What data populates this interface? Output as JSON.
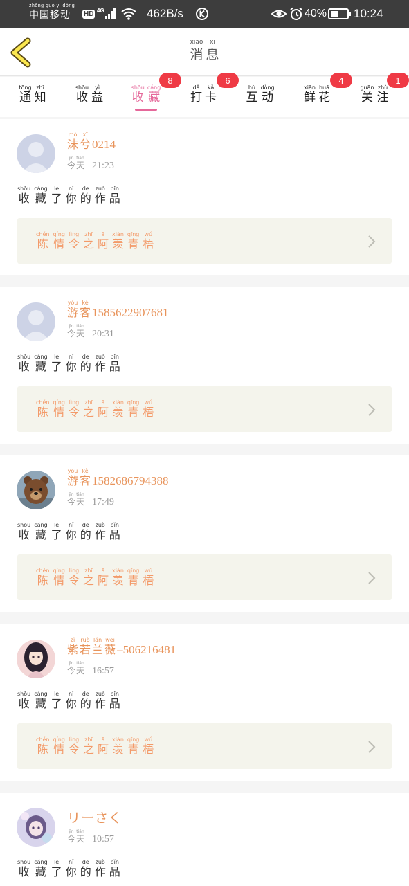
{
  "status_bar": {
    "carrier_pinyin": "zhōng guó yí dòng",
    "carrier": "中国移动",
    "hd": "HD",
    "network": "4G",
    "speed": "462B/s",
    "battery": "40%",
    "time": "10:24"
  },
  "header": {
    "title": [
      {
        "py": "xiāo",
        "hz": "消"
      },
      {
        "py": "xī",
        "hz": "息"
      }
    ]
  },
  "tabs": [
    {
      "chars": [
        {
          "py": "tōng",
          "hz": "通"
        },
        {
          "py": "zhī",
          "hz": "知"
        }
      ],
      "badge": "",
      "active": false
    },
    {
      "chars": [
        {
          "py": "shōu",
          "hz": "收"
        },
        {
          "py": "yì",
          "hz": "益"
        }
      ],
      "badge": "",
      "active": false
    },
    {
      "chars": [
        {
          "py": "shōu",
          "hz": "收"
        },
        {
          "py": "cáng",
          "hz": "藏"
        }
      ],
      "badge": "8",
      "active": true
    },
    {
      "chars": [
        {
          "py": "dǎ",
          "hz": "打"
        },
        {
          "py": "kǎ",
          "hz": "卡"
        }
      ],
      "badge": "6",
      "active": false
    },
    {
      "chars": [
        {
          "py": "hù",
          "hz": "互"
        },
        {
          "py": "dòng",
          "hz": "动"
        }
      ],
      "badge": "",
      "active": false
    },
    {
      "chars": [
        {
          "py": "xiān",
          "hz": "鲜"
        },
        {
          "py": "huā",
          "hz": "花"
        }
      ],
      "badge": "4",
      "active": false
    },
    {
      "chars": [
        {
          "py": "guān",
          "hz": "关"
        },
        {
          "py": "zhù",
          "hz": "注"
        }
      ],
      "badge": "1",
      "active": false
    }
  ],
  "common": {
    "today": [
      {
        "py": "jīn",
        "hz": "今"
      },
      {
        "py": "tiān",
        "hz": "天"
      }
    ],
    "action": [
      {
        "py": "shōu",
        "hz": "收"
      },
      {
        "py": "cáng",
        "hz": "藏"
      },
      {
        "py": "le",
        "hz": "了"
      },
      {
        "py": "nǐ",
        "hz": "你"
      },
      {
        "py": "de",
        "hz": "的"
      },
      {
        "py": "zuò",
        "hz": "作"
      },
      {
        "py": "pǐn",
        "hz": "品"
      }
    ],
    "work": [
      {
        "py": "chén",
        "hz": "陈"
      },
      {
        "py": "qíng",
        "hz": "情"
      },
      {
        "py": "lìng",
        "hz": "令"
      },
      {
        "py": "zhī",
        "hz": "之"
      },
      {
        "py": "ā",
        "hz": "阿"
      },
      {
        "py": "xiàn",
        "hz": "羡"
      },
      {
        "py": "qīng",
        "hz": "青"
      },
      {
        "py": "wú",
        "hz": "梧"
      }
    ]
  },
  "notifications": [
    {
      "avatar": "default-avatar",
      "name_chars": [
        {
          "py": "mò",
          "hz": "沫"
        },
        {
          "py": "xī",
          "hz": "兮"
        }
      ],
      "name_tail": "0214",
      "time": "21:23"
    },
    {
      "avatar": "default-avatar",
      "name_chars": [
        {
          "py": "yóu",
          "hz": "游"
        },
        {
          "py": "kè",
          "hz": "客"
        }
      ],
      "name_tail": "1585622907681",
      "time": "20:31"
    },
    {
      "avatar": "bear-avatar",
      "name_chars": [
        {
          "py": "yóu",
          "hz": "游"
        },
        {
          "py": "kè",
          "hz": "客"
        }
      ],
      "name_tail": "1582686794388",
      "time": "17:49"
    },
    {
      "avatar": "girl-avatar",
      "name_chars": [
        {
          "py": "zǐ",
          "hz": "紫"
        },
        {
          "py": "ruò",
          "hz": "若"
        },
        {
          "py": "lán",
          "hz": "兰"
        },
        {
          "py": "wēi",
          "hz": "薇"
        }
      ],
      "name_tail": "–506216481",
      "time": "16:57"
    },
    {
      "avatar": "anime-avatar",
      "name_chars": [],
      "name_tail": "リーさく",
      "time": "10:57"
    }
  ],
  "colors": {
    "active_tab": "#e5689a",
    "badge": "#ef3a45",
    "name": "#e8935a",
    "work_title": "#f39a69",
    "work_box": "#f4f4ec"
  }
}
